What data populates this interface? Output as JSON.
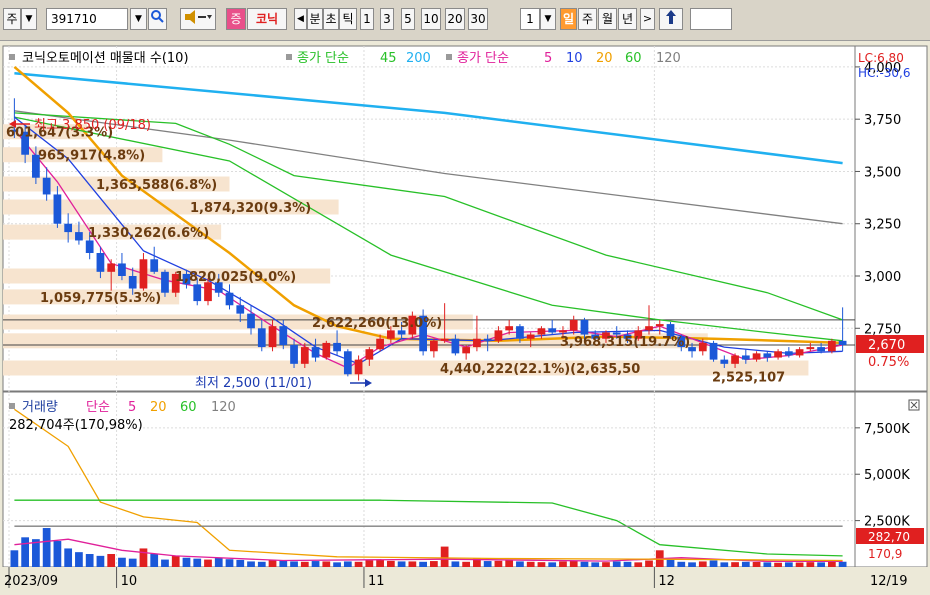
{
  "toolbar": {
    "market": "주",
    "code": "391710",
    "name": "코닉",
    "name_prefix": "증",
    "modes": [
      "분",
      "초",
      "틱"
    ],
    "periods": [
      "1",
      "3",
      "5",
      "10",
      "20",
      "30"
    ],
    "count": "1",
    "periods2": [
      "일",
      "주",
      "월",
      "년"
    ],
    "selected_period": "일"
  },
  "colors": {
    "up": "#e02020",
    "down": "#1b58d8",
    "ma5": "#e0209a",
    "ma10": "#2040e0",
    "ma20": "#f0a000",
    "ma60": "#28c028",
    "ma120": "#808080",
    "ma45": "#28c028",
    "ma200": "#20b0f0"
  },
  "chart_data": [
    {
      "type": "candlestick",
      "legend": {
        "title": "코닉오토메이션 매물대 수(10)",
        "ma_a_label": "종가 단순",
        "ma_a_periods": [
          "45",
          "200"
        ],
        "ma_b_label": "종가 단순",
        "ma_b_periods": [
          "5",
          "10",
          "20",
          "60",
          "120"
        ]
      },
      "ylim": [
        2450,
        4100
      ],
      "yticks": [
        "4,000",
        "3,750",
        "3,500",
        "3,250",
        "3,000",
        "2,750"
      ],
      "ytick_values": [
        4000,
        3750,
        3500,
        3250,
        3000,
        2750
      ],
      "xticks": [
        {
          "label": "2023/09",
          "i": 0
        },
        {
          "label": "10",
          "i": 10
        },
        {
          "label": "11",
          "i": 33
        },
        {
          "label": "12",
          "i": 60
        }
      ],
      "right_label": "12/19",
      "top_labels": [
        "LC:6,80",
        "HC:-30,6"
      ],
      "last_price": "2,670",
      "change_pct": "0.75%",
      "high_label": "최고 3,850 (09/18)",
      "low_label": "최저 2,500 (11/01)",
      "high_index": 0,
      "low_index": 32,
      "candles": [
        [
          3700,
          3850,
          3660,
          3690
        ],
        [
          3690,
          3720,
          3540,
          3580
        ],
        [
          3580,
          3620,
          3440,
          3470
        ],
        [
          3470,
          3520,
          3360,
          3390
        ],
        [
          3390,
          3430,
          3230,
          3250
        ],
        [
          3250,
          3300,
          3160,
          3210
        ],
        [
          3210,
          3260,
          3150,
          3170
        ],
        [
          3170,
          3210,
          3080,
          3110
        ],
        [
          3110,
          3140,
          2990,
          3020
        ],
        [
          3020,
          3080,
          2930,
          3060
        ],
        [
          3060,
          3110,
          2980,
          3000
        ],
        [
          3000,
          3040,
          2910,
          2940
        ],
        [
          2940,
          3110,
          2930,
          3080
        ],
        [
          3080,
          3140,
          3010,
          3020
        ],
        [
          3020,
          3030,
          2900,
          2920
        ],
        [
          2920,
          3020,
          2900,
          3010
        ],
        [
          3010,
          3030,
          2940,
          2960
        ],
        [
          2960,
          2990,
          2860,
          2880
        ],
        [
          2880,
          2990,
          2860,
          2970
        ],
        [
          2970,
          3010,
          2900,
          2920
        ],
        [
          2920,
          2960,
          2840,
          2860
        ],
        [
          2860,
          2900,
          2780,
          2820
        ],
        [
          2820,
          2860,
          2720,
          2750
        ],
        [
          2750,
          2790,
          2640,
          2660
        ],
        [
          2660,
          2790,
          2640,
          2760
        ],
        [
          2760,
          2790,
          2650,
          2670
        ],
        [
          2670,
          2700,
          2560,
          2580
        ],
        [
          2580,
          2680,
          2560,
          2660
        ],
        [
          2660,
          2700,
          2590,
          2610
        ],
        [
          2610,
          2690,
          2600,
          2680
        ],
        [
          2680,
          2740,
          2620,
          2640
        ],
        [
          2640,
          2650,
          2520,
          2530
        ],
        [
          2530,
          2620,
          2500,
          2600
        ],
        [
          2600,
          2660,
          2570,
          2650
        ],
        [
          2650,
          2720,
          2640,
          2700
        ],
        [
          2700,
          2760,
          2680,
          2740
        ],
        [
          2740,
          2780,
          2700,
          2720
        ],
        [
          2720,
          2830,
          2700,
          2810
        ],
        [
          2810,
          2840,
          2620,
          2640
        ],
        [
          2640,
          2700,
          2610,
          2690
        ],
        [
          2690,
          2870,
          2680,
          2700
        ],
        [
          2700,
          2720,
          2620,
          2630
        ],
        [
          2630,
          2670,
          2600,
          2660
        ],
        [
          2660,
          2810,
          2640,
          2700
        ],
        [
          2700,
          2720,
          2640,
          2690
        ],
        [
          2690,
          2760,
          2680,
          2740
        ],
        [
          2740,
          2790,
          2720,
          2760
        ],
        [
          2760,
          2770,
          2680,
          2700
        ],
        [
          2700,
          2730,
          2660,
          2720
        ],
        [
          2720,
          2760,
          2700,
          2750
        ],
        [
          2750,
          2790,
          2720,
          2730
        ],
        [
          2730,
          2760,
          2700,
          2740
        ],
        [
          2740,
          2810,
          2720,
          2790
        ],
        [
          2790,
          2800,
          2690,
          2720
        ],
        [
          2720,
          2740,
          2690,
          2700
        ],
        [
          2700,
          2740,
          2680,
          2730
        ],
        [
          2730,
          2760,
          2700,
          2720
        ],
        [
          2720,
          2740,
          2680,
          2700
        ],
        [
          2700,
          2760,
          2690,
          2740
        ],
        [
          2740,
          2860,
          2720,
          2760
        ],
        [
          2760,
          2790,
          2720,
          2770
        ],
        [
          2770,
          2780,
          2700,
          2710
        ],
        [
          2710,
          2720,
          2640,
          2660
        ],
        [
          2660,
          2680,
          2610,
          2640
        ],
        [
          2640,
          2700,
          2620,
          2680
        ],
        [
          2680,
          2690,
          2590,
          2600
        ],
        [
          2600,
          2620,
          2560,
          2580
        ],
        [
          2580,
          2630,
          2560,
          2620
        ],
        [
          2620,
          2650,
          2580,
          2600
        ],
        [
          2600,
          2640,
          2590,
          2630
        ],
        [
          2630,
          2640,
          2590,
          2610
        ],
        [
          2610,
          2650,
          2600,
          2640
        ],
        [
          2640,
          2660,
          2610,
          2620
        ],
        [
          2620,
          2660,
          2610,
          2650
        ],
        [
          2650,
          2680,
          2640,
          2660
        ],
        [
          2660,
          2680,
          2630,
          2640
        ],
        [
          2640,
          2700,
          2630,
          2690
        ],
        [
          2690,
          2850,
          2640,
          2670
        ]
      ],
      "ma_lines": [
        {
          "period": "200",
          "color": "#20b0f0",
          "points": [
            [
              0,
              3970
            ],
            [
              40,
              3780
            ],
            [
              77,
              3540
            ]
          ]
        },
        {
          "period": "120",
          "color": "#808080",
          "points": [
            [
              0,
              3790
            ],
            [
              20,
              3650
            ],
            [
              40,
              3490
            ],
            [
              77,
              3250
            ]
          ]
        },
        {
          "period": "60",
          "color": "#28c028",
          "points": [
            [
              0,
              3780
            ],
            [
              15,
              3730
            ],
            [
              20,
              3630
            ],
            [
              26,
              3480
            ],
            [
              40,
              3380
            ],
            [
              55,
              3100
            ],
            [
              70,
              2920
            ],
            [
              77,
              2790
            ]
          ]
        },
        {
          "period": "20",
          "color": "#f0a000",
          "points": [
            [
              0,
              4000
            ],
            [
              5,
              3780
            ],
            [
              10,
              3480
            ],
            [
              20,
              3110
            ],
            [
              26,
              2860
            ],
            [
              30,
              2760
            ],
            [
              35,
              2700
            ],
            [
              45,
              2690
            ],
            [
              55,
              2710
            ],
            [
              65,
              2700
            ],
            [
              77,
              2680
            ]
          ]
        },
        {
          "period": "45",
          "color": "#28c028",
          "points": [
            [
              0,
              3760
            ],
            [
              20,
              3550
            ],
            [
              35,
              3100
            ],
            [
              50,
              2860
            ],
            [
              60,
              2790
            ],
            [
              70,
              2730
            ],
            [
              77,
              2690
            ]
          ]
        },
        {
          "period": "10",
          "color": "#2040e0",
          "points": [
            [
              0,
              3760
            ],
            [
              5,
              3560
            ],
            [
              12,
              3120
            ],
            [
              18,
              2980
            ],
            [
              24,
              2800
            ],
            [
              28,
              2660
            ],
            [
              32,
              2580
            ],
            [
              36,
              2700
            ],
            [
              44,
              2690
            ],
            [
              52,
              2730
            ],
            [
              60,
              2740
            ],
            [
              66,
              2660
            ],
            [
              72,
              2630
            ],
            [
              77,
              2640
            ]
          ]
        },
        {
          "period": "5",
          "color": "#e0209a",
          "points": [
            [
              0,
              3700
            ],
            [
              4,
              3450
            ],
            [
              9,
              3060
            ],
            [
              14,
              2980
            ],
            [
              19,
              2930
            ],
            [
              24,
              2760
            ],
            [
              28,
              2630
            ],
            [
              31,
              2560
            ],
            [
              34,
              2660
            ],
            [
              38,
              2720
            ],
            [
              42,
              2660
            ],
            [
              46,
              2730
            ],
            [
              52,
              2740
            ],
            [
              56,
              2710
            ],
            [
              60,
              2760
            ],
            [
              64,
              2680
            ],
            [
              68,
              2600
            ],
            [
              72,
              2620
            ],
            [
              77,
              2670
            ]
          ]
        }
      ],
      "volume_profile": [
        {
          "price": 3690,
          "value": "601,647(3.3%)",
          "width": 0.1
        },
        {
          "price": 3580,
          "value": "965,917(4.8%)",
          "width": 0.19
        },
        {
          "price": 3440,
          "value": "1,363,588(6.8%)",
          "width": 0.27
        },
        {
          "price": 3330,
          "value": "1,874,320(9.3%)",
          "width": 0.4
        },
        {
          "price": 3210,
          "value": "1,330,262(6.6%)",
          "width": 0.26
        },
        {
          "price": 3000,
          "value": "1,820,025(9.0%)",
          "width": 0.39
        },
        {
          "price": 2900,
          "value": "1,059,775(5.3%)",
          "width": 0.21
        },
        {
          "price": 2780,
          "value": "2,622,260(13.0%)",
          "width": 0.56
        },
        {
          "price": 2690,
          "value": "3,968,315(19.7%)",
          "width": 0.84
        },
        {
          "price": 2560,
          "value": "4,440,222(22.1%)(2,635,50",
          "width": 0.96
        },
        {
          "price": 2520,
          "value": "2,525,107",
          "width": 0.0
        }
      ],
      "ref_lines": [
        2790,
        2670
      ]
    },
    {
      "type": "bar",
      "legend": {
        "title": "거래량",
        "ma_label": "단순",
        "ma_periods": [
          "5",
          "20",
          "60",
          "120"
        ]
      },
      "info_label": "282,704주(170,98%)",
      "ylim": [
        0,
        9000
      ],
      "yticks": [
        "7,500K",
        "5,000K",
        "2,500K"
      ],
      "ytick_values": [
        7500,
        5000,
        2500
      ],
      "last_vol": "282,70",
      "last_vol_pct": "170,9",
      "values": [
        900,
        1600,
        1500,
        2100,
        1400,
        1000,
        800,
        700,
        600,
        700,
        500,
        450,
        1000,
        700,
        400,
        600,
        500,
        450,
        400,
        500,
        420,
        380,
        300,
        280,
        350,
        330,
        300,
        280,
        320,
        300,
        250,
        300,
        280,
        350,
        380,
        330,
        300,
        300,
        280,
        320,
        1100,
        300,
        280,
        450,
        320,
        330,
        400,
        300,
        280,
        260,
        250,
        300,
        330,
        280,
        250,
        260,
        300,
        280,
        250,
        350,
        900,
        400,
        280,
        250,
        300,
        350,
        250,
        260,
        280,
        270,
        250,
        230,
        250,
        240,
        260,
        250,
        300,
        283
      ],
      "ma_lines": [
        {
          "period": "5",
          "color": "#e0209a",
          "points": [
            [
              0,
              1200
            ],
            [
              5,
              1500
            ],
            [
              10,
              900
            ],
            [
              15,
              600
            ],
            [
              25,
              350
            ],
            [
              40,
              420
            ],
            [
              55,
              320
            ],
            [
              62,
              500
            ],
            [
              70,
              300
            ],
            [
              77,
              300
            ]
          ]
        },
        {
          "period": "20",
          "color": "#f0a000",
          "points": [
            [
              0,
              8500
            ],
            [
              5,
              6500
            ],
            [
              8,
              3500
            ],
            [
              12,
              2700
            ],
            [
              17,
              2400
            ],
            [
              20,
              900
            ],
            [
              30,
              550
            ],
            [
              45,
              460
            ],
            [
              60,
              420
            ],
            [
              77,
              350
            ]
          ]
        },
        {
          "period": "60",
          "color": "#28c028",
          "points": [
            [
              0,
              3600
            ],
            [
              34,
              3600
            ],
            [
              50,
              3450
            ],
            [
              56,
              2500
            ],
            [
              60,
              1200
            ],
            [
              70,
              700
            ],
            [
              77,
              600
            ]
          ]
        },
        {
          "period": "120",
          "color": "#808080",
          "points": [
            [
              0,
              2200
            ],
            [
              77,
              2200
            ]
          ]
        }
      ]
    }
  ]
}
